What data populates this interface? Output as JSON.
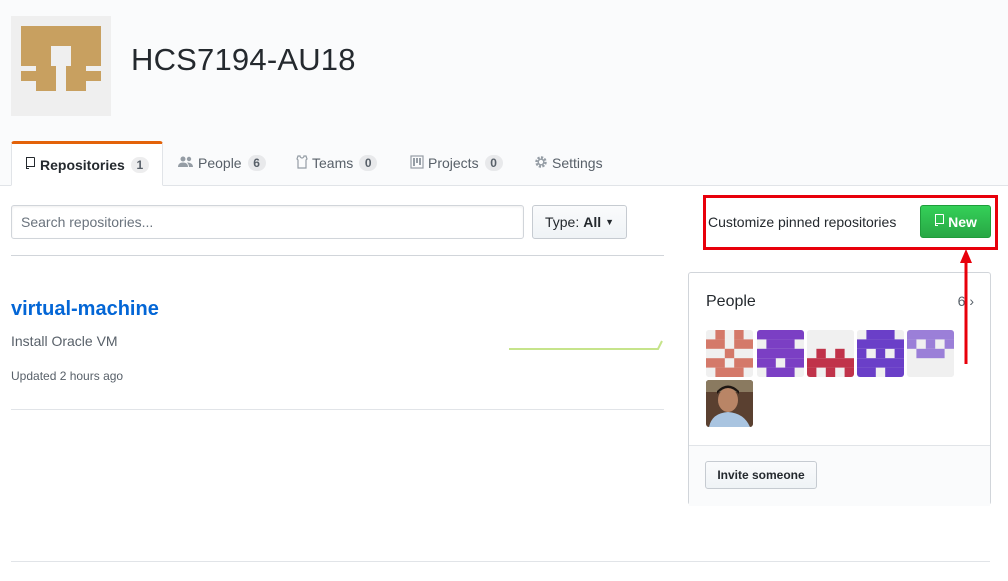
{
  "org": {
    "name": "HCS7194-AU18",
    "avatar_icon": "org-identicon"
  },
  "tabs": [
    {
      "label": "Repositories",
      "count": "1",
      "icon": "repo-icon",
      "selected": true
    },
    {
      "label": "People",
      "count": "6",
      "icon": "people-icon"
    },
    {
      "label": "Teams",
      "count": "0",
      "icon": "jersey-icon"
    },
    {
      "label": "Projects",
      "count": "0",
      "icon": "project-icon"
    },
    {
      "label": "Settings",
      "icon": "gear-icon"
    }
  ],
  "toolbar": {
    "search_placeholder": "Search repositories...",
    "type_label": "Type:",
    "type_value": "All",
    "customize_label": "Customize pinned repositories",
    "new_label": "New"
  },
  "repos": [
    {
      "name": "virtual-machine",
      "description": "Install Oracle VM",
      "updated": "Updated 2 hours ago"
    }
  ],
  "people": {
    "title": "People",
    "count": "6",
    "invite_label": "Invite someone",
    "avatars": [
      "member-avatar-1",
      "member-avatar-2",
      "member-avatar-3",
      "member-avatar-4",
      "member-avatar-5",
      "member-avatar-6"
    ]
  },
  "colors": {
    "accent_tab": "#e36209",
    "link": "#0366d6",
    "new_button": "#28a745",
    "annotation": "#e8000b",
    "sparkline": "#c6e48b"
  }
}
